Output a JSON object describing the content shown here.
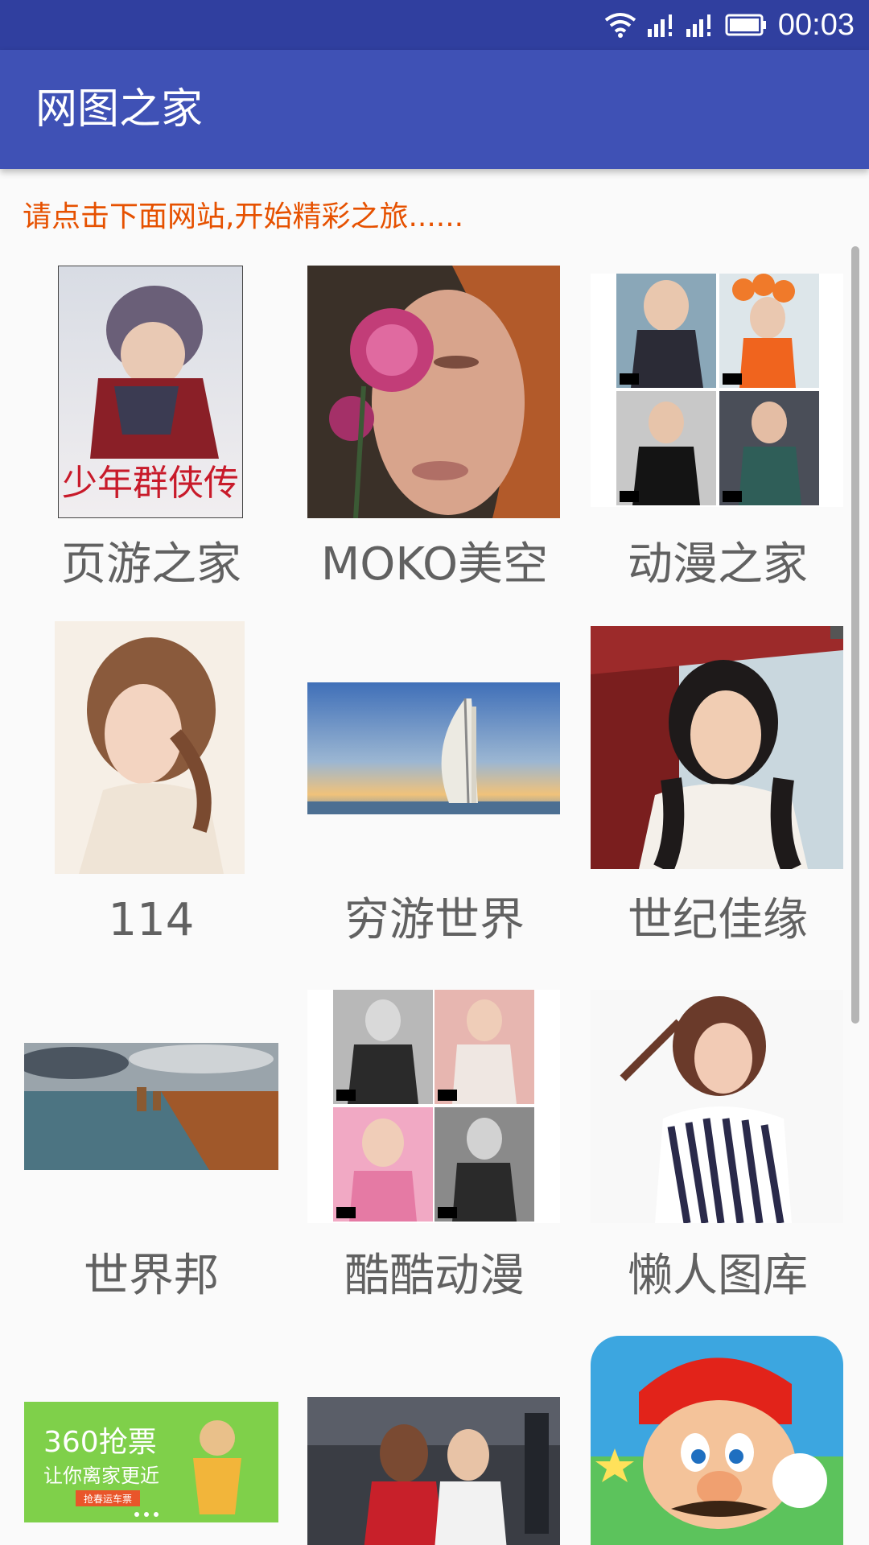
{
  "status_bar": {
    "time": "00:03",
    "icons": [
      "wifi-icon",
      "signal-icon",
      "signal-icon",
      "battery-icon"
    ]
  },
  "app_bar": {
    "title": "网图之家"
  },
  "hint": "请点击下面网站,开始精彩之旅......",
  "sites": [
    {
      "label": "页游之家",
      "image": "game-poster"
    },
    {
      "label": "MOKO美空",
      "image": "portrait-rose"
    },
    {
      "label": "动漫之家",
      "image": "photo-collage"
    },
    {
      "label": "114",
      "image": "portrait-woman"
    },
    {
      "label": "穷游世界",
      "image": "burj-al-arab"
    },
    {
      "label": "世纪佳缘",
      "image": "portrait-boat"
    },
    {
      "label": "世界邦",
      "image": "coast-landscape"
    },
    {
      "label": "酷酷动漫",
      "image": "photo-collage"
    },
    {
      "label": "懒人图库",
      "image": "portrait-striped"
    },
    {
      "label": "",
      "image": "ticket-banner"
    },
    {
      "label": "",
      "image": "basketball"
    },
    {
      "label": "",
      "image": "mario-icon"
    }
  ],
  "banner_text": {
    "line1": "360抢票",
    "line2": "让你离家更近",
    "button": "抢春运车票"
  },
  "poster_text": "少年群侠传"
}
